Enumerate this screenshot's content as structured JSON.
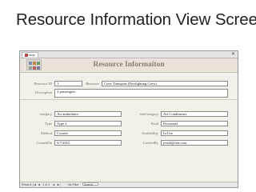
{
  "slide_title": "Resource Information View Screen",
  "window": {
    "tab_label": "rsop",
    "close_glyph": "✕",
    "header_title": "Resource Informaiton",
    "colors": {
      "header_bg": "#eae3d9",
      "body_bg": "#f3efe9",
      "label_text": "#7a6f66",
      "title_text": "#8a7f73"
    }
  },
  "form": {
    "resource_id": {
      "label": "Resource ID",
      "value": "1"
    },
    "resource": {
      "label": "Resource",
      "value": "Crew Transport (Firefighting Crew)"
    },
    "description": {
      "label": "Description",
      "value": "3 passengers"
    },
    "category": {
      "label": "category",
      "value": "Air ambulance"
    },
    "type": {
      "label": "Type",
      "value": "Type 2"
    },
    "method": {
      "label": "Method",
      "value": "Courier"
    },
    "created_on": {
      "label": "CreatedOn",
      "value": "5/7/2012"
    },
    "sub_category": {
      "label": "SubCategory",
      "value": "Air Conditioner"
    },
    "kind": {
      "label": "Kind",
      "value": "Personnel"
    },
    "availability": {
      "label": "Availability",
      "value": "In Use"
    },
    "created_by": {
      "label": "CreatedBy",
      "value": "jessel@ien.com"
    }
  },
  "statusbar": {
    "record_label": "Record:",
    "first": "|◄",
    "prev": "◄",
    "position": "1 of 1",
    "next": "►",
    "last": "►|",
    "filter_status": "No Filter",
    "search_label": "Search"
  }
}
